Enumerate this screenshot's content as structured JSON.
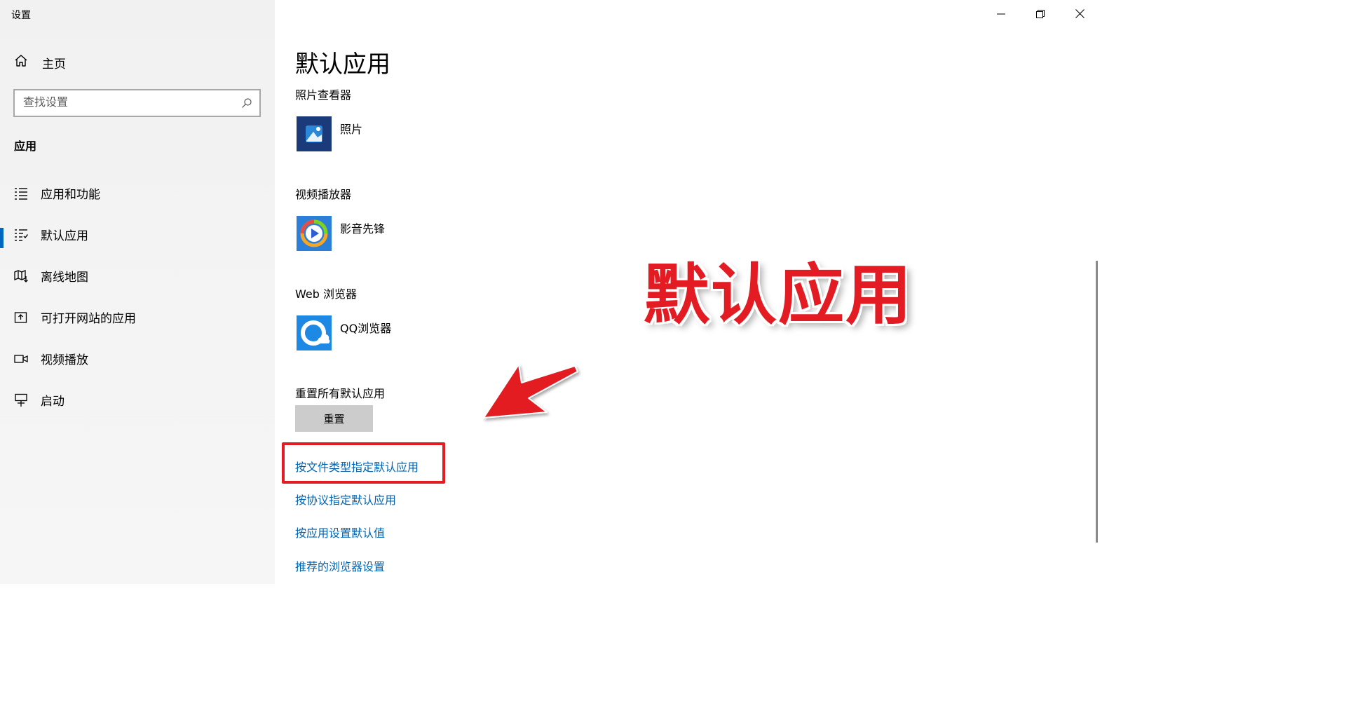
{
  "window": {
    "title": "设置",
    "controls": [
      "minimize",
      "restore",
      "close"
    ]
  },
  "sidebar": {
    "home_label": "主页",
    "search": {
      "placeholder": "查找设置",
      "value": ""
    },
    "section_label": "应用",
    "items": [
      {
        "label": "应用和功能",
        "icon": "apps-features-icon",
        "active": false
      },
      {
        "label": "默认应用",
        "icon": "default-apps-icon",
        "active": true
      },
      {
        "label": "离线地图",
        "icon": "offline-maps-icon",
        "active": false
      },
      {
        "label": "可打开网站的应用",
        "icon": "apps-for-websites-icon",
        "active": false
      },
      {
        "label": "视频播放",
        "icon": "video-playback-icon",
        "active": false
      },
      {
        "label": "启动",
        "icon": "startup-icon",
        "active": false
      }
    ]
  },
  "main": {
    "title": "默认应用",
    "groups": [
      {
        "label": "照片查看器",
        "app_name": "照片",
        "icon": "photos-app-icon"
      },
      {
        "label": "视频播放器",
        "app_name": "影音先锋",
        "icon": "xfplay-app-icon"
      },
      {
        "label": "Web 浏览器",
        "app_name": "QQ浏览器",
        "icon": "qq-browser-icon"
      }
    ],
    "reset_label": "重置所有默认应用",
    "reset_button": "重置",
    "links": [
      "按文件类型指定默认应用",
      "按协议指定默认应用",
      "按应用设置默认值",
      "推荐的浏览器设置"
    ]
  },
  "annotation": {
    "overlay_text": "默认应用",
    "color": "#e31b23"
  },
  "colors": {
    "accent": "#0067c0",
    "link": "#0063b1",
    "sidebar_bg": "#f2f2f2",
    "button_bg": "#cccccc"
  }
}
